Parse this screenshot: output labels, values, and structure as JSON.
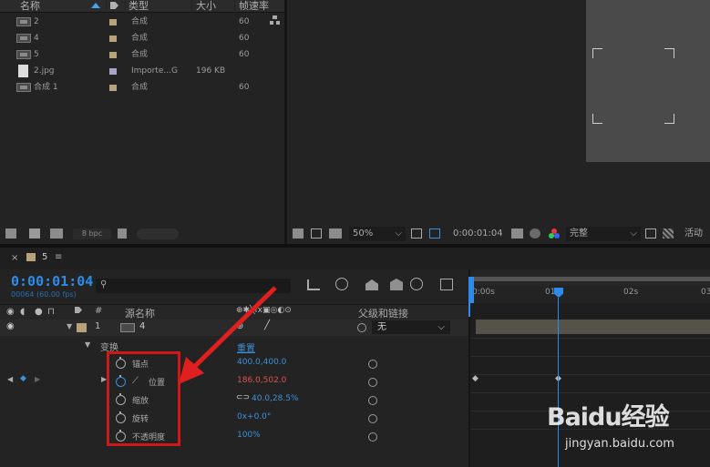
{
  "project": {
    "columns": {
      "name": "名称",
      "type": "类型",
      "size": "大小",
      "fps": "帧速率"
    },
    "items": [
      {
        "name": "2",
        "type": "合成",
        "size": "",
        "fps": "60",
        "kind": "comp",
        "label_color": "#b7a27a"
      },
      {
        "name": "4",
        "type": "合成",
        "size": "",
        "fps": "60",
        "kind": "comp",
        "label_color": "#b7a27a"
      },
      {
        "name": "5",
        "type": "合成",
        "size": "",
        "fps": "60",
        "kind": "comp",
        "label_color": "#b7a27a"
      },
      {
        "name": "2.jpg",
        "type": "Importe...G",
        "size": "196 KB",
        "fps": "",
        "kind": "file",
        "label_color": "#a7a6c9"
      },
      {
        "name": "合成 1",
        "type": "合成",
        "size": "",
        "fps": "60",
        "kind": "comp",
        "label_color": "#b7a27a"
      }
    ],
    "bpc": "8 bpc"
  },
  "viewer": {
    "zoom": "50%",
    "timecode": "0:00:01:04",
    "resolution": "完整",
    "active_label": "活动"
  },
  "timeline": {
    "tab_name": "5",
    "current_time": "0:00:01:04",
    "frame_info": "00064 (60.00 fps)",
    "search_placeholder": "",
    "columns": {
      "num": "#",
      "source_name": "源名称",
      "parent": "父级和链接"
    },
    "layer": {
      "index": "1",
      "name": "4",
      "parent_value": "无"
    },
    "transform_label": "变换",
    "reset_label": "重置",
    "properties": [
      {
        "name": "锚点",
        "value": "400.0,400.0",
        "color": "#3e8fd8"
      },
      {
        "name": "位置",
        "value": "186.0,502.0",
        "color": "#d9534f"
      },
      {
        "name": "缩放",
        "value": "40.0,28.5%",
        "color": "#3e8fd8"
      },
      {
        "name": "旋转",
        "value": "0x+0.0°",
        "color": "#3e8fd8"
      },
      {
        "name": "不透明度",
        "value": "100%",
        "color": "#3e8fd8"
      }
    ],
    "ruler": [
      "0:00s",
      "01s",
      "02s",
      "03"
    ]
  },
  "watermark": {
    "logo": "Baidu经验",
    "url": "jingyan.baidu.com"
  },
  "colors": {
    "accent_blue": "#2d8ceb",
    "annotation_red": "#d01818",
    "label_tan": "#b7a27a"
  }
}
